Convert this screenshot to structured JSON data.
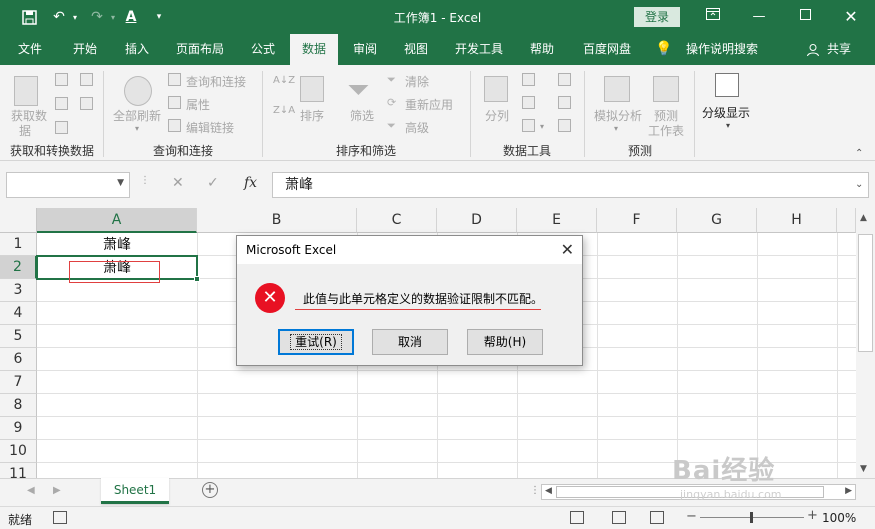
{
  "titlebar": {
    "doc_title": "工作簿1  -  Excel",
    "login": "登录",
    "save_icon": "save-icon",
    "undo_icon": "undo-icon",
    "redo_icon": "redo-icon",
    "font_color_icon": "font-color-icon"
  },
  "tabs": [
    "文件",
    "开始",
    "插入",
    "页面布局",
    "公式",
    "数据",
    "审阅",
    "视图",
    "开发工具",
    "帮助",
    "百度网盘",
    "操作说明搜索"
  ],
  "active_tab": "数据",
  "share": "共享",
  "ribbon": {
    "groups": {
      "get_data": "获取和转换数据",
      "queries": "查询和连接",
      "sort_filter": "排序和筛选",
      "data_tools": "数据工具",
      "forecast": "预测"
    },
    "get_data_btn": [
      "获取数",
      "据"
    ],
    "refresh_all_btn": "全部刷新",
    "queries_conn": "查询和连接",
    "properties": "属性",
    "edit_links": "编辑链接",
    "sort": "排序",
    "filter": "筛选",
    "clear": "清除",
    "reapply": "重新应用",
    "advanced": "高级",
    "split": "分列",
    "what_if": "模拟分析",
    "forecast_sheet": [
      "预测",
      "工作表"
    ],
    "outline": "分级显示"
  },
  "formula_bar": {
    "name_box": "",
    "value": "萧峰",
    "fx": "fx"
  },
  "columns": [
    "A",
    "B",
    "C",
    "D",
    "E",
    "F",
    "G",
    "H"
  ],
  "rows": [
    "1",
    "2",
    "3",
    "4",
    "5",
    "6",
    "7",
    "8",
    "9",
    "10",
    "11"
  ],
  "cells": {
    "A1": "萧峰",
    "A2": "萧峰"
  },
  "sheet_tab": "Sheet1",
  "status": {
    "ready": "就绪",
    "zoom": "100%"
  },
  "dialog": {
    "title": "Microsoft Excel",
    "message": "此值与此单元格定义的数据验证限制不匹配。",
    "retry": "重试(R)",
    "cancel": "取消",
    "help": "帮助(H)"
  },
  "watermark": {
    "brand": "Bai经验",
    "url": "jingyan.baidu.com"
  },
  "colors": {
    "excel_green": "#217346",
    "error_red": "#e81123",
    "focus_blue": "#0078d7"
  }
}
